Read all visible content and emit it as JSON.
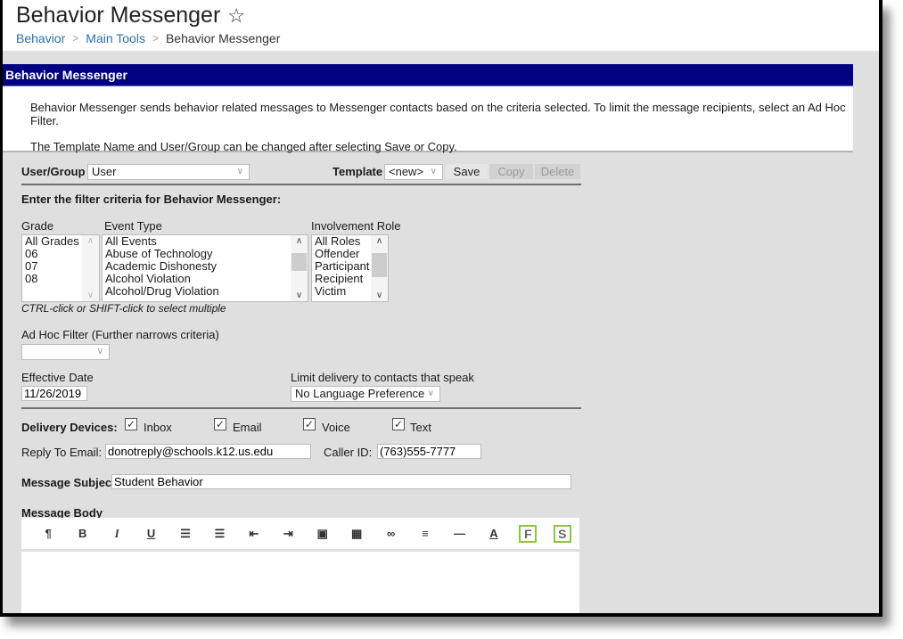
{
  "header": {
    "title": "Behavior Messenger",
    "breadcrumb": [
      "Behavior",
      "Main Tools",
      "Behavior Messenger"
    ]
  },
  "panel": {
    "title": "Behavior Messenger",
    "intro_1": "Behavior Messenger sends behavior related messages to Messenger contacts based on the criteria selected. To limit the message recipients, select an Ad Hoc Filter.",
    "intro_2": "The Template Name and User/Group can be changed after selecting Save or Copy."
  },
  "user_group": {
    "label": "User/Group",
    "value": "User"
  },
  "template": {
    "label": "Template",
    "value": "<new>",
    "save_label": "Save",
    "copy_label": "Copy",
    "delete_label": "Delete"
  },
  "filter_heading": "Enter the filter criteria for Behavior Messenger:",
  "grade": {
    "label": "Grade",
    "options": [
      "All Grades",
      "06",
      "07",
      "08"
    ]
  },
  "event_type": {
    "label": "Event Type",
    "options": [
      "All Events",
      "Abuse of Technology",
      "Academic Dishonesty",
      "Alcohol Violation",
      "Alcohol/Drug Violation"
    ]
  },
  "involvement_role": {
    "label": "Involvement Role",
    "options": [
      "All Roles",
      "Offender",
      "Participant",
      "Recipient",
      "Victim"
    ]
  },
  "multi_select_hint": "CTRL-click or SHIFT-click to select multiple",
  "ad_hoc": {
    "label": "Ad Hoc Filter (Further narrows criteria)",
    "value": ""
  },
  "effective_date": {
    "label": "Effective Date",
    "value": "11/26/2019"
  },
  "language": {
    "label": "Limit delivery to contacts that speak",
    "value": "No Language Preference"
  },
  "delivery": {
    "label": "Delivery Devices:",
    "devices": [
      {
        "label": "Inbox",
        "checked": true
      },
      {
        "label": "Email",
        "checked": true
      },
      {
        "label": "Voice",
        "checked": true
      },
      {
        "label": "Text",
        "checked": true
      }
    ]
  },
  "reply_to": {
    "label": "Reply To Email:",
    "value": "donotreply@schools.k12.us.edu"
  },
  "caller_id": {
    "label": "Caller ID:",
    "value": "(763)555-7777"
  },
  "subject": {
    "label": "Message Subject",
    "value": "Student Behavior"
  },
  "body": {
    "label": "Message Body",
    "toolbar": [
      {
        "name": "paragraph-icon",
        "glyph": "¶"
      },
      {
        "name": "bold-icon",
        "glyph": "B"
      },
      {
        "name": "italic-icon",
        "glyph": "I"
      },
      {
        "name": "underline-icon",
        "glyph": "U"
      },
      {
        "name": "bulleted-list-icon",
        "glyph": "☰"
      },
      {
        "name": "numbered-list-icon",
        "glyph": "☰"
      },
      {
        "name": "outdent-icon",
        "glyph": "⇤"
      },
      {
        "name": "indent-icon",
        "glyph": "⇥"
      },
      {
        "name": "image-icon",
        "glyph": "▣"
      },
      {
        "name": "table-icon",
        "glyph": "▦"
      },
      {
        "name": "link-icon",
        "glyph": "∞"
      },
      {
        "name": "align-icon",
        "glyph": "≡"
      },
      {
        "name": "horizontal-rule-icon",
        "glyph": "—"
      },
      {
        "name": "font-color-icon",
        "glyph": "A"
      },
      {
        "name": "field-insert-icon",
        "glyph": "F"
      },
      {
        "name": "sub-report-icon",
        "glyph": "S"
      }
    ],
    "value": ""
  }
}
